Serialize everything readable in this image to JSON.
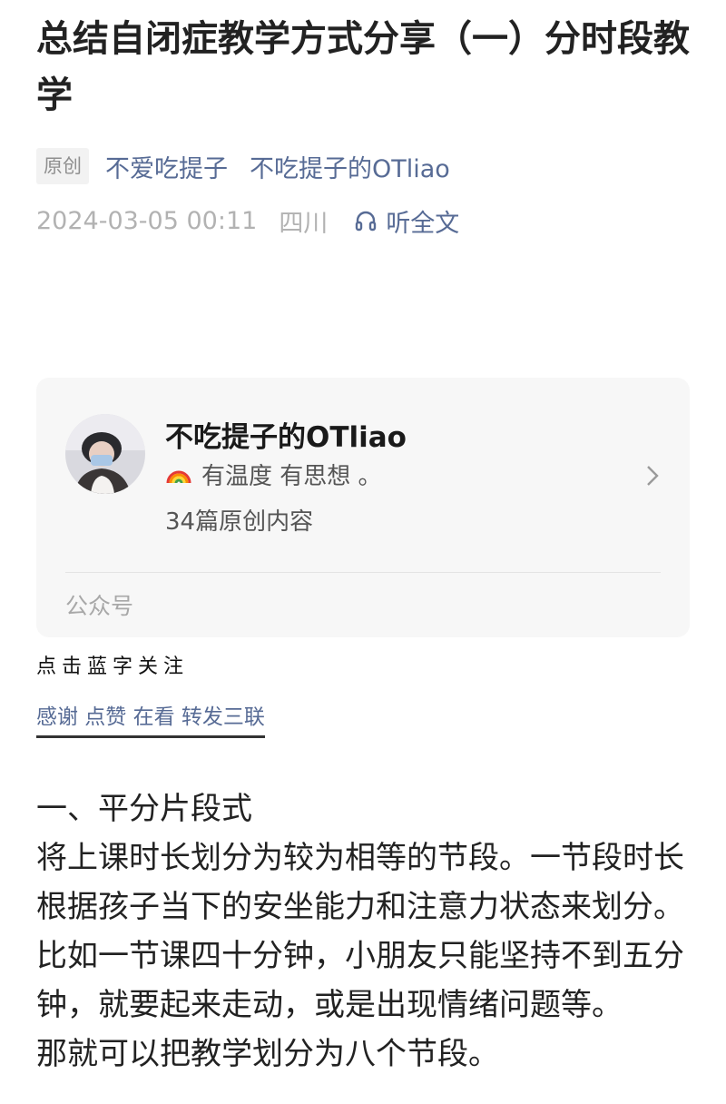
{
  "article": {
    "title": "总结自闭症教学方式分享（一）分时段教学",
    "original_tag": "原创",
    "author": "不爱吃提子",
    "account_link": "不吃提子的OTliao",
    "date": "2024-03-05 00:11",
    "location": "四川",
    "listen_label": "听全文"
  },
  "account_card": {
    "name": "不吃提子的OTliao",
    "emoji_icon": "rainbow-icon",
    "description": "有温度 有思想 。",
    "count": "34篇原创内容",
    "footer": "公众号"
  },
  "follow_hint": "点击蓝字关注",
  "thanks_line": "感谢 点赞 在看 转发三联",
  "body": {
    "heading": "一、平分片段式",
    "paragraph1": "将上课时长划分为较为相等的节段。一节段时长根据孩子当下的安坐能力和注意力状态来划分。",
    "paragraph2": "比如一节课四十分钟，小朋友只能坚持不到五分钟，就要起来走动，或是出现情绪问题等。",
    "paragraph3": "那就可以把教学划分为八个节段。"
  },
  "colors": {
    "link": "#576b95",
    "muted": "#b2b2b2",
    "card_bg": "#f7f7f7"
  }
}
